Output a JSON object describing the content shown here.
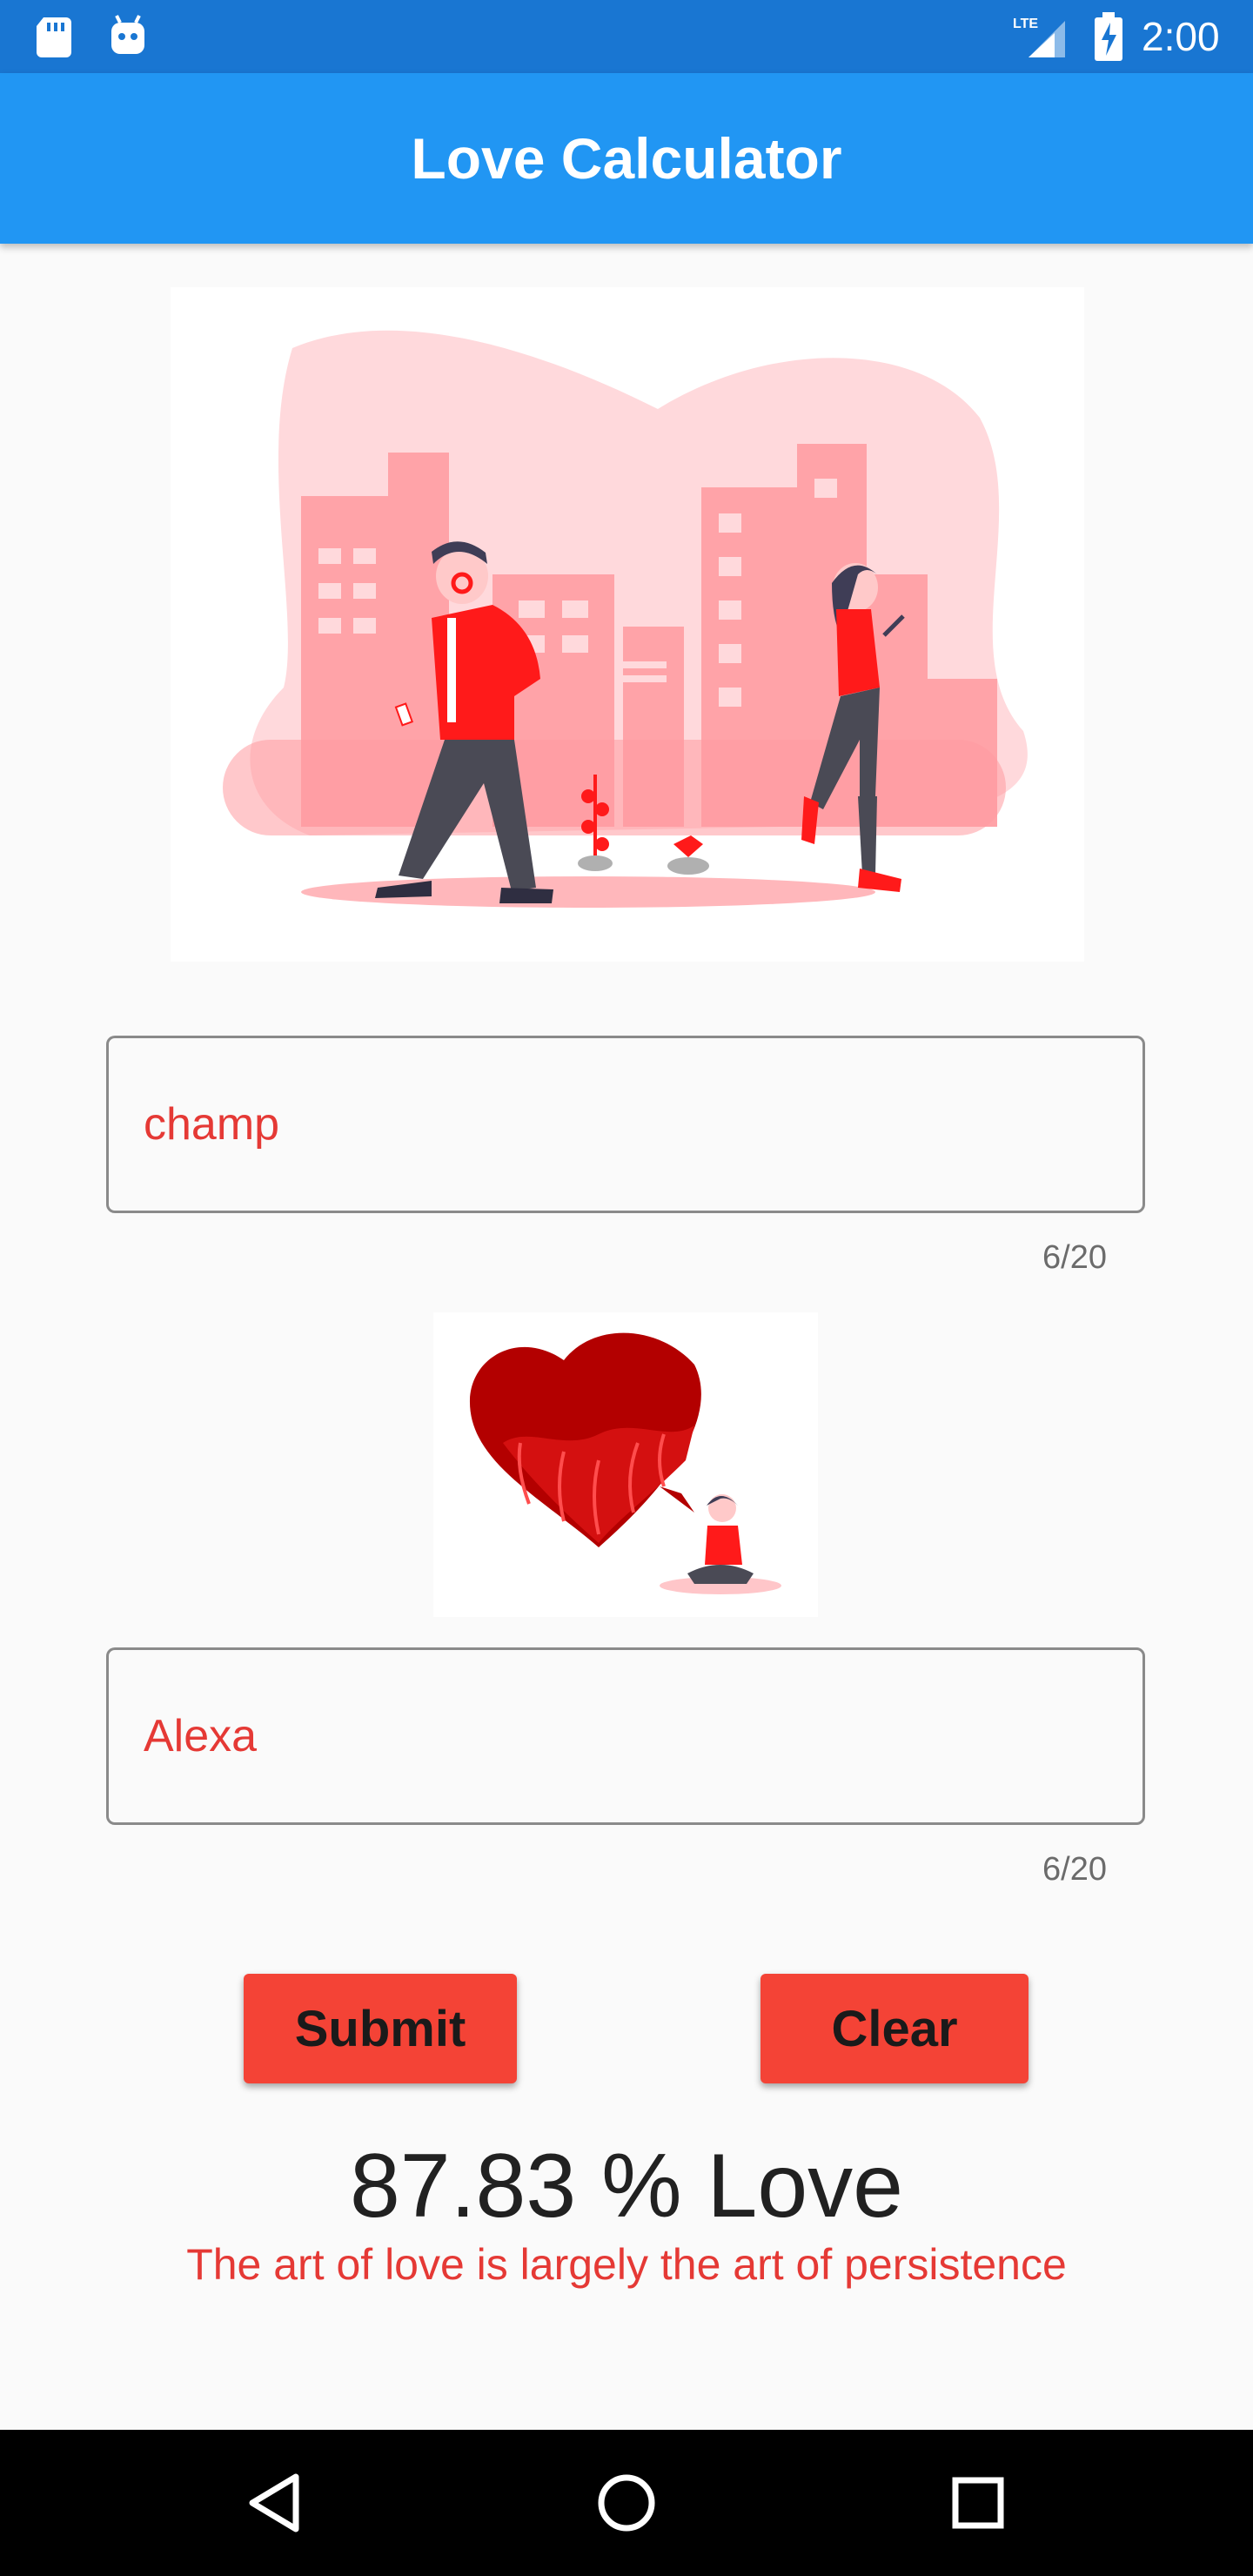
{
  "status_bar": {
    "time": "2:00",
    "network": "LTE",
    "icons": [
      "sd-card-icon",
      "android-icon",
      "lte-signal-icon",
      "battery-charging-icon"
    ]
  },
  "app_bar": {
    "title": "Love Calculator"
  },
  "form": {
    "name1": {
      "value": "champ",
      "counter": "6/20"
    },
    "name2": {
      "value": "Alexa",
      "counter": "6/20"
    }
  },
  "buttons": {
    "submit_label": "Submit",
    "clear_label": "Clear"
  },
  "result": {
    "text": "87.83 % Love",
    "quote": "The art of love is largely the art of persistence"
  },
  "nav_bar": {
    "icons": [
      "back-icon",
      "home-icon",
      "recents-icon"
    ]
  },
  "colors": {
    "status_bar": "#1976d2",
    "app_bar": "#2196f3",
    "accent_red": "#f44336",
    "input_text": "#e53935",
    "background": "#fafafa"
  }
}
